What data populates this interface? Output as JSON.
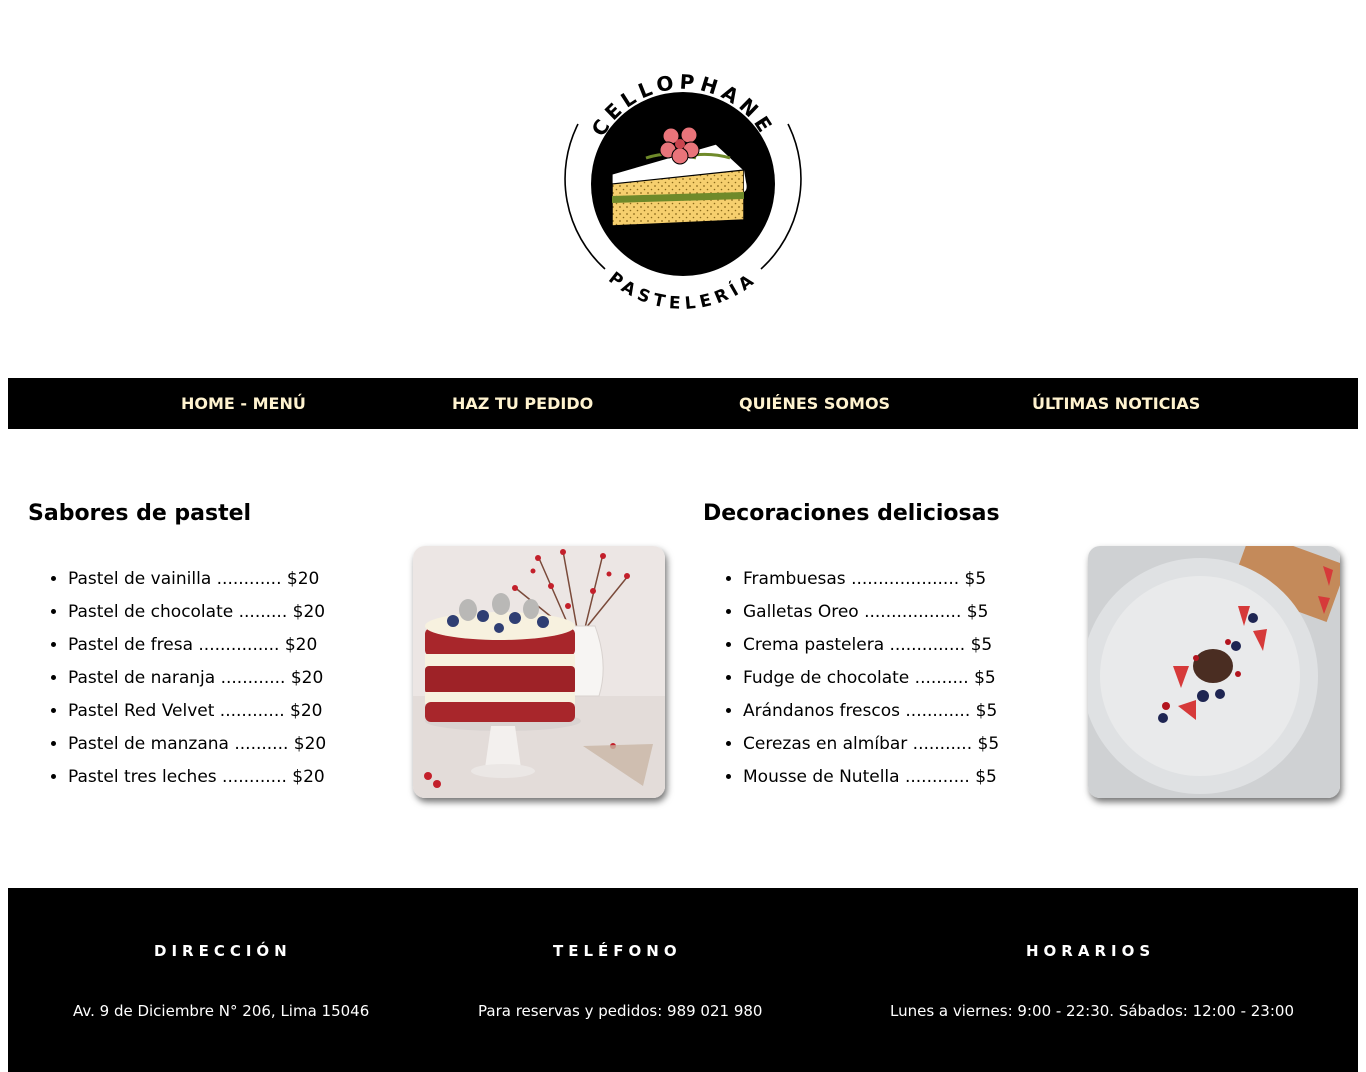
{
  "logo": {
    "brand": "CELLOPHANE",
    "subtitle": "PASTELERÍA"
  },
  "nav": {
    "items": [
      {
        "label": "HOME - MENÚ"
      },
      {
        "label": "HAZ TU PEDIDO"
      },
      {
        "label": "QUIÉNES SOMOS"
      },
      {
        "label": "ÚLTIMAS NOTICIAS"
      }
    ]
  },
  "flavors": {
    "title": "Sabores de pastel",
    "items": [
      {
        "text": "Pastel de vainilla ............ $20"
      },
      {
        "text": "Pastel de chocolate ......... $20"
      },
      {
        "text": "Pastel de fresa ............... $20"
      },
      {
        "text": "Pastel de naranja ............ $20"
      },
      {
        "text": "Pastel Red Velvet ............ $20"
      },
      {
        "text": "Pastel de manzana .......... $20"
      },
      {
        "text": "Pastel tres leches ............ $20"
      }
    ]
  },
  "decorations": {
    "title": "Decoraciones deliciosas",
    "items": [
      {
        "text": "Frambuesas .................... $5"
      },
      {
        "text": "Galletas Oreo .................. $5"
      },
      {
        "text": "Crema pastelera .............. $5"
      },
      {
        "text": "Fudge de chocolate .......... $5"
      },
      {
        "text": "Arándanos frescos ............ $5"
      },
      {
        "text": "Cerezas en almíbar ........... $5"
      },
      {
        "text": "Mousse de Nutella ............ $5"
      }
    ]
  },
  "footer": {
    "address": {
      "heading": "DIRECCIÓN",
      "text": "Av. 9 de Diciembre N° 206, Lima 15046"
    },
    "phone": {
      "heading": "TELÉFONO",
      "text": "Para reservas y pedidos: 989 021 980"
    },
    "hours": {
      "heading": "HORARIOS",
      "text": "Lunes a viernes: 9:00 - 22:30. Sábados: 12:00 - 23:00"
    }
  },
  "colors": {
    "nav_background": "#000000",
    "nav_text": "#fff3cf",
    "footer_background": "#000000",
    "footer_text": "#ffffff"
  }
}
